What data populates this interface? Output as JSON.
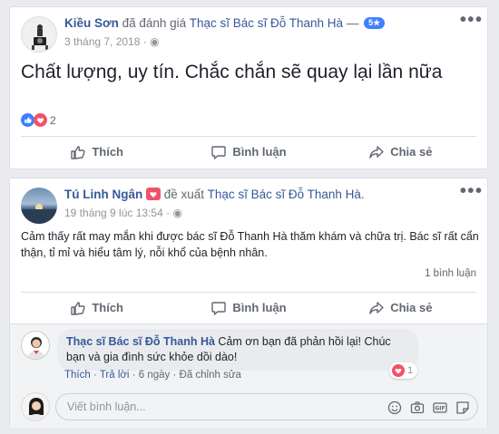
{
  "post1": {
    "author": "Kiều Sơn",
    "verb": "đã đánh giá",
    "page": "Thạc sĩ Bác sĩ Đỗ Thanh Hà",
    "dash": "—",
    "rating": "5★",
    "date": "3 tháng 7, 2018",
    "text": "Chất lượng, uy tín. Chắc chắn sẽ quay lại lần nữa",
    "reaction_count": "2",
    "actions": {
      "like": "Thích",
      "comment": "Bình luận",
      "share": "Chia sẻ"
    }
  },
  "post2": {
    "author": "Tú Linh Ngân",
    "verb": "đề xuất",
    "page": "Thạc sĩ Bác sĩ Đỗ Thanh Hà.",
    "date": "19 tháng 9 lúc 13:54",
    "text": "Cảm thấy rất may mắn khi được bác sĩ Đỗ Thanh Hà thăm khám và chữa trị. Bác sĩ rất cẩn thận, tỉ mỉ và hiểu tâm lý, nỗi khổ của bệnh nhân.",
    "comment_count": "1 bình luận",
    "actions": {
      "like": "Thích",
      "comment": "Bình luận",
      "share": "Chia sẻ"
    },
    "reply": {
      "author": "Thạc sĩ Bác sĩ Đỗ Thanh Hà",
      "text": "Cảm ơn bạn đã phản hồi lại! Chúc bạn và gia đình sức khỏe dồi dào!",
      "like": "Thích",
      "reply": "Trả lời",
      "time": "6 ngày",
      "edited": "Đã chỉnh sửa",
      "reaction_count": "1"
    },
    "composer": {
      "placeholder": "Viết bình luận..."
    }
  },
  "colors": {
    "link": "#365899",
    "like_blue": "#4080ff",
    "heart_red": "#f25268"
  }
}
